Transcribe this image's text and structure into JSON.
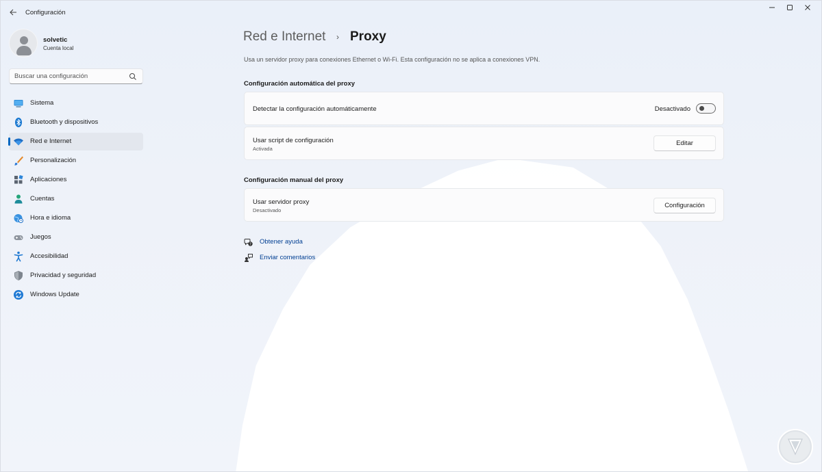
{
  "window": {
    "title": "Configuración",
    "back_icon": "arrow-left-icon",
    "controls": [
      "minimize",
      "maximize",
      "close"
    ]
  },
  "profile": {
    "name": "solvetic",
    "account_type": "Cuenta local"
  },
  "search": {
    "placeholder": "Buscar una configuración"
  },
  "sidebar": {
    "items": [
      {
        "label": "Sistema",
        "icon": "monitor-icon",
        "active": false
      },
      {
        "label": "Bluetooth y dispositivos",
        "icon": "bluetooth-icon",
        "active": false
      },
      {
        "label": "Red e Internet",
        "icon": "wifi-icon",
        "active": true
      },
      {
        "label": "Personalización",
        "icon": "brush-icon",
        "active": false
      },
      {
        "label": "Aplicaciones",
        "icon": "apps-icon",
        "active": false
      },
      {
        "label": "Cuentas",
        "icon": "person-icon",
        "active": false
      },
      {
        "label": "Hora e idioma",
        "icon": "globe-clock-icon",
        "active": false
      },
      {
        "label": "Juegos",
        "icon": "gamepad-icon",
        "active": false
      },
      {
        "label": "Accesibilidad",
        "icon": "accessibility-icon",
        "active": false
      },
      {
        "label": "Privacidad y seguridad",
        "icon": "shield-icon",
        "active": false
      },
      {
        "label": "Windows Update",
        "icon": "update-icon",
        "active": false
      }
    ]
  },
  "breadcrumb": {
    "parent": "Red e Internet",
    "separator": "›",
    "current": "Proxy"
  },
  "description": "Usa un servidor proxy para conexiones Ethernet o Wi-Fi. Esta configuración no se aplica a conexiones VPN.",
  "auto_section": {
    "title": "Configuración automática del proxy",
    "detect": {
      "label": "Detectar la configuración automáticamente",
      "state_label": "Desactivado",
      "on": false
    },
    "script": {
      "label": "Usar script de configuración",
      "status": "Activada",
      "button": "Editar"
    }
  },
  "manual_section": {
    "title": "Configuración manual del proxy",
    "server": {
      "label": "Usar servidor proxy",
      "status": "Desactivado",
      "button": "Configuración"
    }
  },
  "links": [
    {
      "label": "Obtener ayuda",
      "icon": "help-icon"
    },
    {
      "label": "Enviar comentarios",
      "icon": "feedback-icon"
    }
  ],
  "colors": {
    "accent": "#0067c0",
    "link": "#003e92"
  }
}
